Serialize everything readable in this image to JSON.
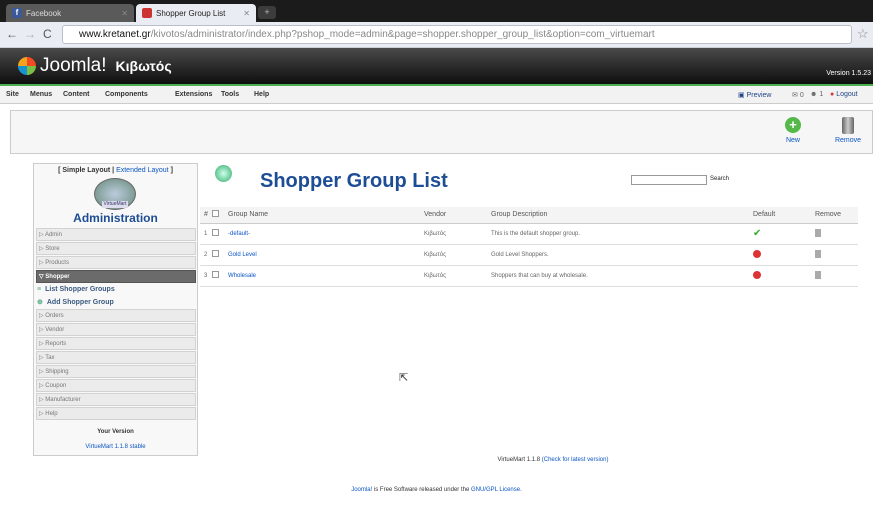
{
  "browser": {
    "tabs": [
      {
        "title": "Facebook"
      },
      {
        "title": "Shopper Group List"
      }
    ],
    "url_domain": "www.kretanet.gr",
    "url_path": "/kivotos/administrator/index.php?pshop_mode=admin&page=shopper.shopper_group_list&option=com_virtuemart"
  },
  "header": {
    "logo": "Joomla!",
    "site_name": "Κιβωτός",
    "version": "Version 1.5.23"
  },
  "menu": {
    "items": [
      "Site",
      "Menus",
      "Content",
      "Components",
      "Extensions",
      "Tools",
      "Help"
    ],
    "preview": "Preview",
    "messages": "0",
    "users": "1",
    "logout": "Logout"
  },
  "toolbar": {
    "new_label": "New",
    "remove_label": "Remove"
  },
  "sidebar": {
    "layout_simple": "[ Simple Layout |",
    "layout_extended": "Extended Layout",
    "layout_close": "]",
    "logo_text": "VirtueMart",
    "title": "Administration",
    "items": [
      "Admin",
      "Store",
      "Products",
      "Shopper",
      "Orders",
      "Vendor",
      "Reports",
      "Tax",
      "Shipping",
      "Coupon",
      "Manufacturer",
      "Help"
    ],
    "sub_items": [
      "List Shopper Groups",
      "Add Shopper Group"
    ],
    "your_version": "Your Version",
    "version": "VirtueMart 1.1.8 stable"
  },
  "page": {
    "title": "Shopper Group List",
    "search_label": "Search"
  },
  "table": {
    "headers": {
      "num": "#",
      "name": "Group Name",
      "vendor": "Vendor",
      "desc": "Group Description",
      "default": "Default",
      "remove": "Remove"
    },
    "rows": [
      {
        "num": "1",
        "name": "-default-",
        "vendor": "Κιβωτός",
        "desc": "This is the default shopper group."
      },
      {
        "num": "2",
        "name": "Gold Level",
        "vendor": "Κιβωτός",
        "desc": "Gold Level Shoppers."
      },
      {
        "num": "3",
        "name": "Wholesale",
        "vendor": "Κιβωτός",
        "desc": "Shoppers that can buy at wholesale."
      }
    ]
  },
  "footer": {
    "vm_version": "VirtueMart 1.1.8",
    "check_link": "(Check for latest version)",
    "joomla": "Joomla!",
    "free_text": " is Free Software released under the ",
    "license": "GNU/GPL License."
  }
}
